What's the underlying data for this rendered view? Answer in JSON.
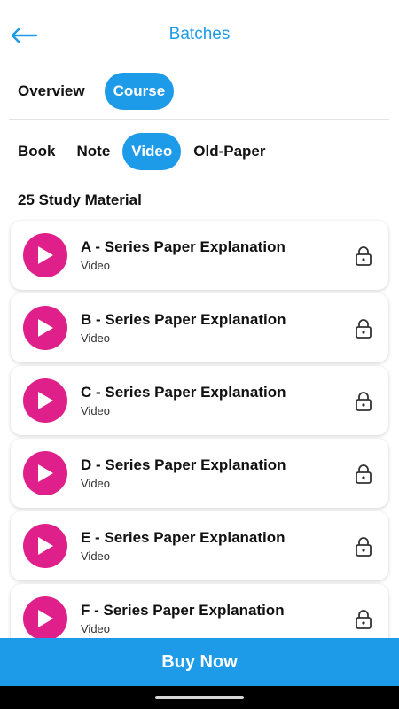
{
  "header": {
    "title": "Batches",
    "back_icon": "arrow-left-icon"
  },
  "main_tabs": [
    {
      "label": "Overview",
      "active": false
    },
    {
      "label": "Course",
      "active": true
    }
  ],
  "sub_tabs": [
    {
      "label": "Book",
      "active": false
    },
    {
      "label": "Note",
      "active": false
    },
    {
      "label": "Video",
      "active": true
    },
    {
      "label": "Old-Paper",
      "active": false
    }
  ],
  "material_count": "25 Study Material",
  "items": [
    {
      "title": "A - Series Paper Explanation",
      "type": "Video"
    },
    {
      "title": "B - Series Paper Explanation",
      "type": "Video"
    },
    {
      "title": "C - Series Paper Explanation",
      "type": "Video"
    },
    {
      "title": "D - Series Paper Explanation",
      "type": "Video"
    },
    {
      "title": "E - Series Paper Explanation",
      "type": "Video"
    },
    {
      "title": "F - Series Paper Explanation",
      "type": "Video"
    }
  ],
  "buy_button": "Buy Now",
  "colors": {
    "accent": "#1e9be8",
    "play": "#e0208a"
  }
}
